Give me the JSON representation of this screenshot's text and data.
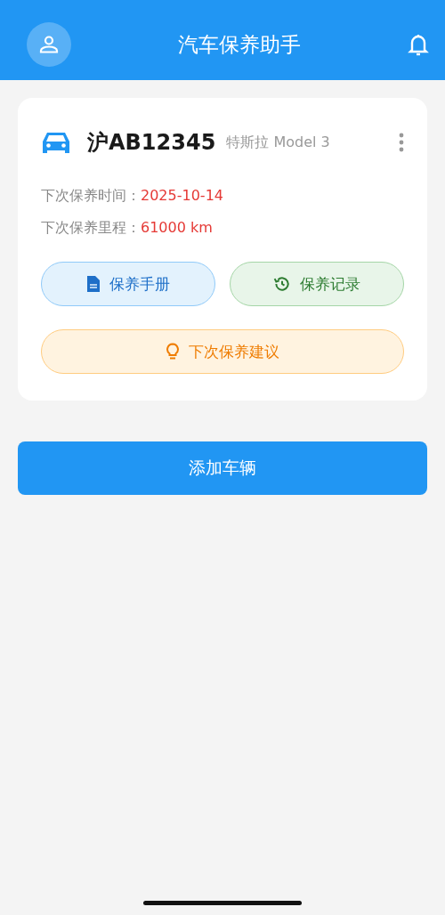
{
  "header": {
    "title": "汽车保养助手"
  },
  "vehicles": [
    {
      "plate": "沪AB12345",
      "model": "特斯拉 Model 3",
      "info": [
        {
          "label": "下次保养时间：",
          "value": "2025-10-14"
        },
        {
          "label": "下次保养里程：",
          "value": "61000 km"
        }
      ],
      "actions": [
        {
          "kind": "manual",
          "label": "保养手册"
        },
        {
          "kind": "history",
          "label": "保养记录"
        },
        {
          "kind": "advice",
          "label": "下次保养建议"
        }
      ]
    }
  ],
  "add_button": {
    "label": "添加车辆"
  }
}
